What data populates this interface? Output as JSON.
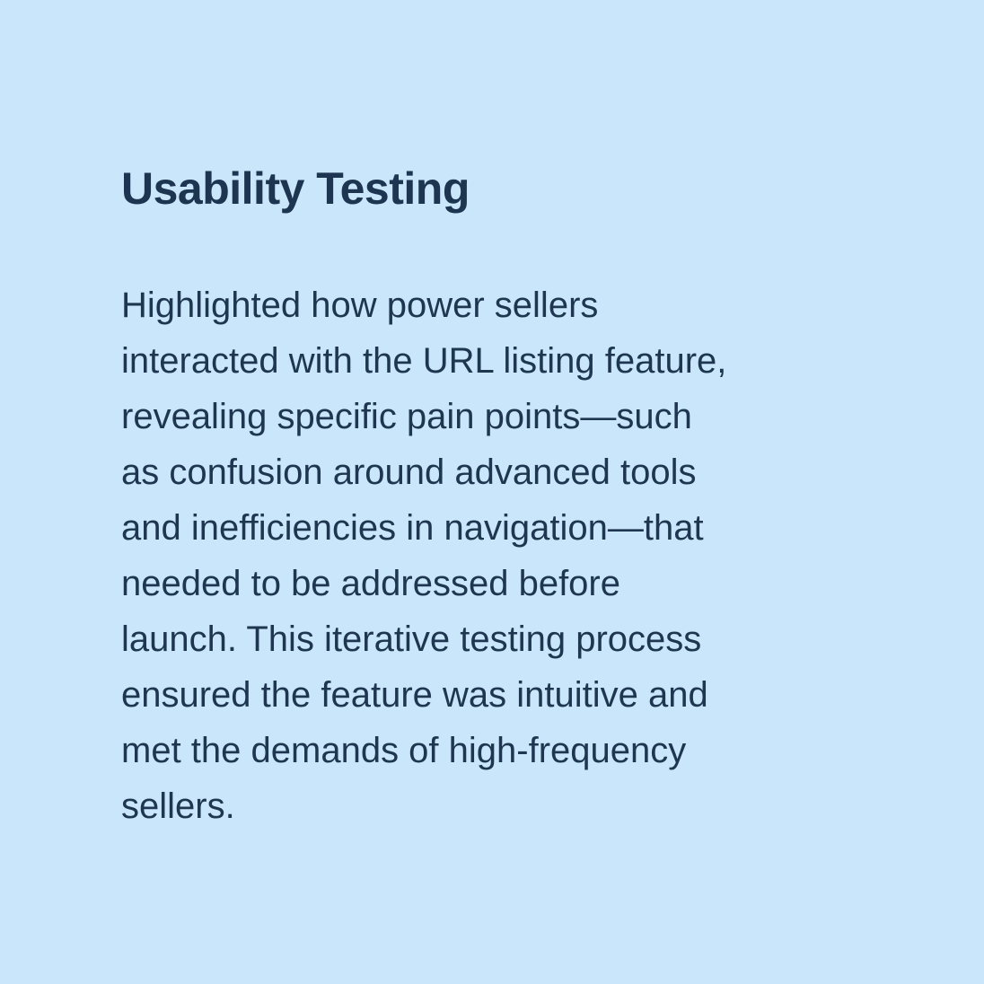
{
  "background_color": "#c9e6fa",
  "text_color": "#1f3650",
  "section": {
    "title": "Usability Testing",
    "body_lines": [
      "Highlighted how power sellers",
      "interacted with the URL listing feature,",
      "revealing specific pain points—such",
      "as confusion around advanced tools",
      "and inefficiencies in navigation—that",
      "needed to be addressed before",
      "launch. This iterative testing process",
      "ensured the feature was intuitive and",
      "met the demands of high-frequency",
      "sellers."
    ]
  }
}
